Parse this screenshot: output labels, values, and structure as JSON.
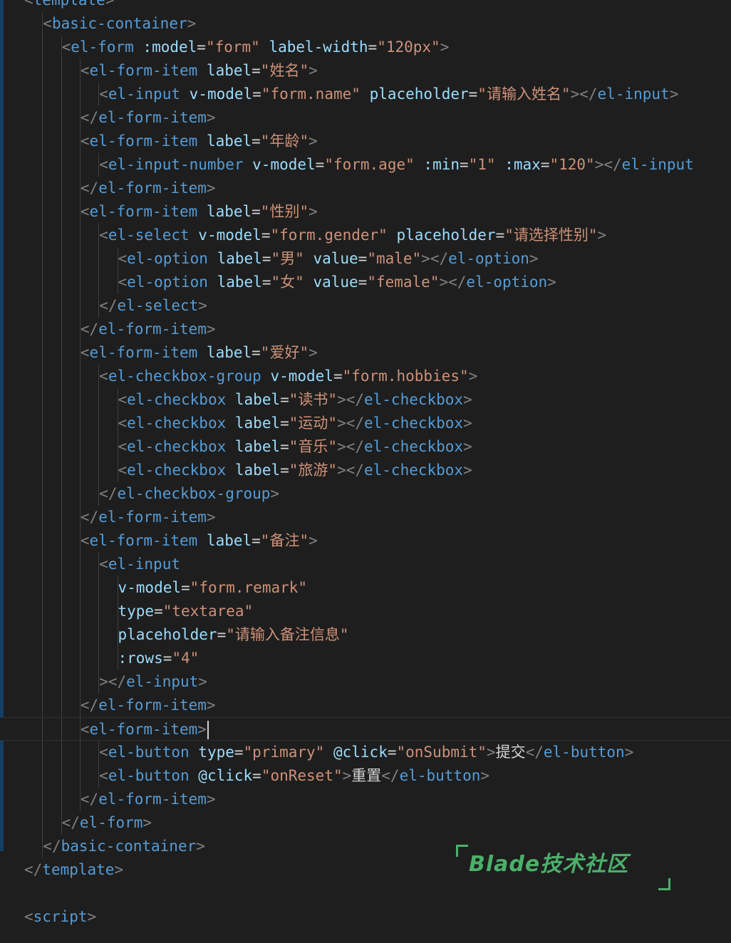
{
  "editor": {
    "language": "vue",
    "lines": [
      {
        "indent": 1,
        "tokens": [
          [
            "t-punct",
            "<"
          ],
          [
            "t-tag",
            "template"
          ],
          [
            "t-punct",
            ">"
          ]
        ]
      },
      {
        "indent": 3,
        "tokens": [
          [
            "t-punct",
            "<"
          ],
          [
            "t-tag",
            "basic-container"
          ],
          [
            "t-punct",
            ">"
          ]
        ]
      },
      {
        "indent": 4,
        "tokens": [
          [
            "t-punct",
            "<"
          ],
          [
            "t-tag",
            "el-form"
          ],
          [
            "t-text",
            " "
          ],
          [
            "t-attr",
            ":model"
          ],
          [
            "t-text",
            "="
          ],
          [
            "t-str",
            "\"form\""
          ],
          [
            "t-text",
            " "
          ],
          [
            "t-attr",
            "label-width"
          ],
          [
            "t-text",
            "="
          ],
          [
            "t-str",
            "\"120px\""
          ],
          [
            "t-punct",
            ">"
          ]
        ]
      },
      {
        "indent": 5,
        "tokens": [
          [
            "t-punct",
            "<"
          ],
          [
            "t-tag",
            "el-form-item"
          ],
          [
            "t-text",
            " "
          ],
          [
            "t-attr",
            "label"
          ],
          [
            "t-text",
            "="
          ],
          [
            "t-str",
            "\"姓名\""
          ],
          [
            "t-punct",
            ">"
          ]
        ]
      },
      {
        "indent": 6,
        "tokens": [
          [
            "t-punct",
            "<"
          ],
          [
            "t-tag",
            "el-input"
          ],
          [
            "t-text",
            " "
          ],
          [
            "t-attr",
            "v-model"
          ],
          [
            "t-text",
            "="
          ],
          [
            "t-str",
            "\"form.name\""
          ],
          [
            "t-text",
            " "
          ],
          [
            "t-attr",
            "placeholder"
          ],
          [
            "t-text",
            "="
          ],
          [
            "t-str",
            "\"请输入姓名\""
          ],
          [
            "t-punct",
            "></"
          ],
          [
            "t-tag",
            "el-input"
          ],
          [
            "t-punct",
            ">"
          ]
        ]
      },
      {
        "indent": 5,
        "tokens": [
          [
            "t-punct",
            "</"
          ],
          [
            "t-tag",
            "el-form-item"
          ],
          [
            "t-punct",
            ">"
          ]
        ]
      },
      {
        "indent": 5,
        "tokens": [
          [
            "t-punct",
            "<"
          ],
          [
            "t-tag",
            "el-form-item"
          ],
          [
            "t-text",
            " "
          ],
          [
            "t-attr",
            "label"
          ],
          [
            "t-text",
            "="
          ],
          [
            "t-str",
            "\"年龄\""
          ],
          [
            "t-punct",
            ">"
          ]
        ]
      },
      {
        "indent": 6,
        "tokens": [
          [
            "t-punct",
            "<"
          ],
          [
            "t-tag",
            "el-input-number"
          ],
          [
            "t-text",
            " "
          ],
          [
            "t-attr",
            "v-model"
          ],
          [
            "t-text",
            "="
          ],
          [
            "t-str",
            "\"form.age\""
          ],
          [
            "t-text",
            " "
          ],
          [
            "t-attr",
            ":min"
          ],
          [
            "t-text",
            "="
          ],
          [
            "t-str",
            "\"1\""
          ],
          [
            "t-text",
            " "
          ],
          [
            "t-attr",
            ":max"
          ],
          [
            "t-text",
            "="
          ],
          [
            "t-str",
            "\"120\""
          ],
          [
            "t-punct",
            "></"
          ],
          [
            "t-tag",
            "el-input"
          ]
        ]
      },
      {
        "indent": 5,
        "tokens": [
          [
            "t-punct",
            "</"
          ],
          [
            "t-tag",
            "el-form-item"
          ],
          [
            "t-punct",
            ">"
          ]
        ]
      },
      {
        "indent": 5,
        "tokens": [
          [
            "t-punct",
            "<"
          ],
          [
            "t-tag",
            "el-form-item"
          ],
          [
            "t-text",
            " "
          ],
          [
            "t-attr",
            "label"
          ],
          [
            "t-text",
            "="
          ],
          [
            "t-str",
            "\"性别\""
          ],
          [
            "t-punct",
            ">"
          ]
        ]
      },
      {
        "indent": 6,
        "tokens": [
          [
            "t-punct",
            "<"
          ],
          [
            "t-tag",
            "el-select"
          ],
          [
            "t-text",
            " "
          ],
          [
            "t-attr",
            "v-model"
          ],
          [
            "t-text",
            "="
          ],
          [
            "t-str",
            "\"form.gender\""
          ],
          [
            "t-text",
            " "
          ],
          [
            "t-attr",
            "placeholder"
          ],
          [
            "t-text",
            "="
          ],
          [
            "t-str",
            "\"请选择性别\""
          ],
          [
            "t-punct",
            ">"
          ]
        ]
      },
      {
        "indent": 7,
        "tokens": [
          [
            "t-punct",
            "<"
          ],
          [
            "t-tag",
            "el-option"
          ],
          [
            "t-text",
            " "
          ],
          [
            "t-attr",
            "label"
          ],
          [
            "t-text",
            "="
          ],
          [
            "t-str",
            "\"男\""
          ],
          [
            "t-text",
            " "
          ],
          [
            "t-attr",
            "value"
          ],
          [
            "t-text",
            "="
          ],
          [
            "t-str",
            "\"male\""
          ],
          [
            "t-punct",
            "></"
          ],
          [
            "t-tag",
            "el-option"
          ],
          [
            "t-punct",
            ">"
          ]
        ]
      },
      {
        "indent": 7,
        "tokens": [
          [
            "t-punct",
            "<"
          ],
          [
            "t-tag",
            "el-option"
          ],
          [
            "t-text",
            " "
          ],
          [
            "t-attr",
            "label"
          ],
          [
            "t-text",
            "="
          ],
          [
            "t-str",
            "\"女\""
          ],
          [
            "t-text",
            " "
          ],
          [
            "t-attr",
            "value"
          ],
          [
            "t-text",
            "="
          ],
          [
            "t-str",
            "\"female\""
          ],
          [
            "t-punct",
            "></"
          ],
          [
            "t-tag",
            "el-option"
          ],
          [
            "t-punct",
            ">"
          ]
        ]
      },
      {
        "indent": 6,
        "tokens": [
          [
            "t-punct",
            "</"
          ],
          [
            "t-tag",
            "el-select"
          ],
          [
            "t-punct",
            ">"
          ]
        ]
      },
      {
        "indent": 5,
        "tokens": [
          [
            "t-punct",
            "</"
          ],
          [
            "t-tag",
            "el-form-item"
          ],
          [
            "t-punct",
            ">"
          ]
        ]
      },
      {
        "indent": 5,
        "tokens": [
          [
            "t-punct",
            "<"
          ],
          [
            "t-tag",
            "el-form-item"
          ],
          [
            "t-text",
            " "
          ],
          [
            "t-attr",
            "label"
          ],
          [
            "t-text",
            "="
          ],
          [
            "t-str",
            "\"爱好\""
          ],
          [
            "t-punct",
            ">"
          ]
        ]
      },
      {
        "indent": 6,
        "tokens": [
          [
            "t-punct",
            "<"
          ],
          [
            "t-tag",
            "el-checkbox-group"
          ],
          [
            "t-text",
            " "
          ],
          [
            "t-attr",
            "v-model"
          ],
          [
            "t-text",
            "="
          ],
          [
            "t-str",
            "\"form.hobbies\""
          ],
          [
            "t-punct",
            ">"
          ]
        ]
      },
      {
        "indent": 7,
        "tokens": [
          [
            "t-punct",
            "<"
          ],
          [
            "t-tag",
            "el-checkbox"
          ],
          [
            "t-text",
            " "
          ],
          [
            "t-attr",
            "label"
          ],
          [
            "t-text",
            "="
          ],
          [
            "t-str",
            "\"读书\""
          ],
          [
            "t-punct",
            "></"
          ],
          [
            "t-tag",
            "el-checkbox"
          ],
          [
            "t-punct",
            ">"
          ]
        ]
      },
      {
        "indent": 7,
        "tokens": [
          [
            "t-punct",
            "<"
          ],
          [
            "t-tag",
            "el-checkbox"
          ],
          [
            "t-text",
            " "
          ],
          [
            "t-attr",
            "label"
          ],
          [
            "t-text",
            "="
          ],
          [
            "t-str",
            "\"运动\""
          ],
          [
            "t-punct",
            "></"
          ],
          [
            "t-tag",
            "el-checkbox"
          ],
          [
            "t-punct",
            ">"
          ]
        ]
      },
      {
        "indent": 7,
        "tokens": [
          [
            "t-punct",
            "<"
          ],
          [
            "t-tag",
            "el-checkbox"
          ],
          [
            "t-text",
            " "
          ],
          [
            "t-attr",
            "label"
          ],
          [
            "t-text",
            "="
          ],
          [
            "t-str",
            "\"音乐\""
          ],
          [
            "t-punct",
            "></"
          ],
          [
            "t-tag",
            "el-checkbox"
          ],
          [
            "t-punct",
            ">"
          ]
        ]
      },
      {
        "indent": 7,
        "tokens": [
          [
            "t-punct",
            "<"
          ],
          [
            "t-tag",
            "el-checkbox"
          ],
          [
            "t-text",
            " "
          ],
          [
            "t-attr",
            "label"
          ],
          [
            "t-text",
            "="
          ],
          [
            "t-str",
            "\"旅游\""
          ],
          [
            "t-punct",
            "></"
          ],
          [
            "t-tag",
            "el-checkbox"
          ],
          [
            "t-punct",
            ">"
          ]
        ]
      },
      {
        "indent": 6,
        "tokens": [
          [
            "t-punct",
            "</"
          ],
          [
            "t-tag",
            "el-checkbox-group"
          ],
          [
            "t-punct",
            ">"
          ]
        ]
      },
      {
        "indent": 5,
        "tokens": [
          [
            "t-punct",
            "</"
          ],
          [
            "t-tag",
            "el-form-item"
          ],
          [
            "t-punct",
            ">"
          ]
        ]
      },
      {
        "indent": 5,
        "tokens": [
          [
            "t-punct",
            "<"
          ],
          [
            "t-tag",
            "el-form-item"
          ],
          [
            "t-text",
            " "
          ],
          [
            "t-attr",
            "label"
          ],
          [
            "t-text",
            "="
          ],
          [
            "t-str",
            "\"备注\""
          ],
          [
            "t-punct",
            ">"
          ]
        ]
      },
      {
        "indent": 6,
        "tokens": [
          [
            "t-punct",
            "<"
          ],
          [
            "t-tag",
            "el-input"
          ]
        ]
      },
      {
        "indent": 7,
        "tokens": [
          [
            "t-attr",
            "v-model"
          ],
          [
            "t-text",
            "="
          ],
          [
            "t-str",
            "\"form.remark\""
          ]
        ]
      },
      {
        "indent": 7,
        "tokens": [
          [
            "t-attr",
            "type"
          ],
          [
            "t-text",
            "="
          ],
          [
            "t-str",
            "\"textarea\""
          ]
        ]
      },
      {
        "indent": 7,
        "tokens": [
          [
            "t-attr",
            "placeholder"
          ],
          [
            "t-text",
            "="
          ],
          [
            "t-str",
            "\"请输入备注信息\""
          ]
        ]
      },
      {
        "indent": 7,
        "tokens": [
          [
            "t-attr",
            ":rows"
          ],
          [
            "t-text",
            "="
          ],
          [
            "t-str",
            "\"4\""
          ]
        ]
      },
      {
        "indent": 6,
        "tokens": [
          [
            "t-punct",
            "></"
          ],
          [
            "t-tag",
            "el-input"
          ],
          [
            "t-punct",
            ">"
          ]
        ]
      },
      {
        "indent": 5,
        "tokens": [
          [
            "t-punct",
            "</"
          ],
          [
            "t-tag",
            "el-form-item"
          ],
          [
            "t-punct",
            ">"
          ]
        ]
      },
      {
        "indent": 5,
        "current": true,
        "tokens": [
          [
            "t-punct",
            "<"
          ],
          [
            "t-tag",
            "el-form-item"
          ],
          [
            "t-punct",
            ">"
          ]
        ]
      },
      {
        "indent": 6,
        "tokens": [
          [
            "t-punct",
            "<"
          ],
          [
            "t-tag",
            "el-button"
          ],
          [
            "t-text",
            " "
          ],
          [
            "t-attr",
            "type"
          ],
          [
            "t-text",
            "="
          ],
          [
            "t-str",
            "\"primary\""
          ],
          [
            "t-text",
            " "
          ],
          [
            "t-attr",
            "@click"
          ],
          [
            "t-text",
            "="
          ],
          [
            "t-str",
            "\"onSubmit\""
          ],
          [
            "t-punct",
            ">"
          ],
          [
            "t-text",
            "提交"
          ],
          [
            "t-punct",
            "</"
          ],
          [
            "t-tag",
            "el-button"
          ],
          [
            "t-punct",
            ">"
          ]
        ]
      },
      {
        "indent": 6,
        "tokens": [
          [
            "t-punct",
            "<"
          ],
          [
            "t-tag",
            "el-button"
          ],
          [
            "t-text",
            " "
          ],
          [
            "t-attr",
            "@click"
          ],
          [
            "t-text",
            "="
          ],
          [
            "t-str",
            "\"onReset\""
          ],
          [
            "t-punct",
            ">"
          ],
          [
            "t-text",
            "重置"
          ],
          [
            "t-punct",
            "</"
          ],
          [
            "t-tag",
            "el-button"
          ],
          [
            "t-punct",
            ">"
          ]
        ]
      },
      {
        "indent": 5,
        "tokens": [
          [
            "t-punct",
            "</"
          ],
          [
            "t-tag",
            "el-form-item"
          ],
          [
            "t-punct",
            ">"
          ]
        ]
      },
      {
        "indent": 4,
        "tokens": [
          [
            "t-punct",
            "</"
          ],
          [
            "t-tag",
            "el-form"
          ],
          [
            "t-punct",
            ">"
          ]
        ]
      },
      {
        "indent": 3,
        "tokens": [
          [
            "t-punct",
            "</"
          ],
          [
            "t-tag",
            "basic-container"
          ],
          [
            "t-punct",
            ">"
          ]
        ]
      },
      {
        "indent": 1,
        "tokens": [
          [
            "t-punct",
            "</"
          ],
          [
            "t-tag",
            "template"
          ],
          [
            "t-punct",
            ">"
          ]
        ]
      },
      {
        "indent": 0,
        "tokens": []
      },
      {
        "indent": 1,
        "tokens": [
          [
            "t-punct",
            "<"
          ],
          [
            "t-tag",
            "script"
          ],
          [
            "t-punct",
            ">"
          ]
        ]
      }
    ]
  },
  "watermark": {
    "text": "Blade技术社区",
    "color": "#4caf6a"
  },
  "colors": {
    "background": "#1e1e1e",
    "tag": "#569cd6",
    "attribute": "#9cdcfe",
    "string": "#ce9178",
    "text": "#d4d4d4",
    "punctuation": "#808080"
  }
}
